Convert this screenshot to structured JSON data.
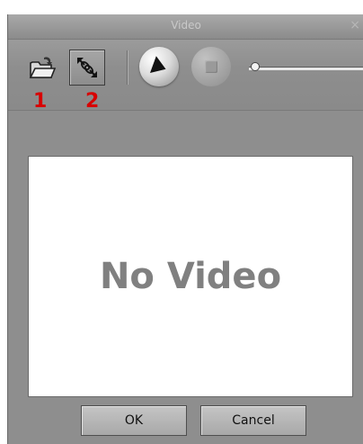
{
  "window": {
    "title": "Video",
    "close_glyph": "×"
  },
  "toolbar": {
    "open_icon": "folder-open-icon",
    "link_icon": "chain-link-resize-icon",
    "play_icon": "play-icon",
    "stop_icon": "stop-icon",
    "volume_slider_level": 0.02
  },
  "annotations": {
    "label_1": "1",
    "label_2": "2"
  },
  "video": {
    "placeholder": "No Video"
  },
  "buttons": {
    "ok": "OK",
    "cancel": "Cancel"
  },
  "colors": {
    "annotation_red": "#d80000",
    "placeholder_gray": "#808080"
  }
}
